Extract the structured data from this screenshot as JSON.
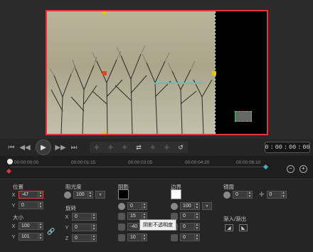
{
  "transport": {
    "timecode": [
      "0",
      ":",
      "00",
      ":",
      "00",
      ":",
      "00"
    ],
    "buttons": [
      "⏮",
      "◀◀",
      "▶",
      "▶▶",
      "⏭"
    ]
  },
  "ruler": {
    "ticks": [
      "00:00:00:00",
      "00:00:01:15",
      "00:00:03:05",
      "00:00:04:20",
      "00:00:06:10"
    ]
  },
  "position": {
    "title": "位置",
    "x_label": "X",
    "x_value": "-47",
    "y_label": "Y",
    "y_value": "0"
  },
  "size": {
    "title": "大小",
    "x_label": "X",
    "x_value": "100",
    "y_label": "Y",
    "y_value": "101"
  },
  "opacity": {
    "title": "阻光度",
    "value": "100"
  },
  "rotation": {
    "title": "旋转",
    "x_label": "X",
    "x_value": "0",
    "y_label": "Y",
    "y_value": "0",
    "z_label": "Z",
    "z_value": "0"
  },
  "shadow": {
    "title": "阴影",
    "color": "#000000",
    "values": [
      "0",
      "15",
      "-40",
      "10"
    ],
    "tooltip": "阴影不透明度"
  },
  "border": {
    "title": "边界",
    "color": "#ffffff",
    "values": [
      "100",
      "0",
      "0",
      "0"
    ]
  },
  "mirror": {
    "title": "镜面",
    "values": [
      "0",
      "0"
    ]
  },
  "fade": {
    "title": "渐入/渐出"
  },
  "colors": {
    "accent_red": "#d83b3b",
    "handle": "#e8c400",
    "guide": "#3ad2c6"
  }
}
